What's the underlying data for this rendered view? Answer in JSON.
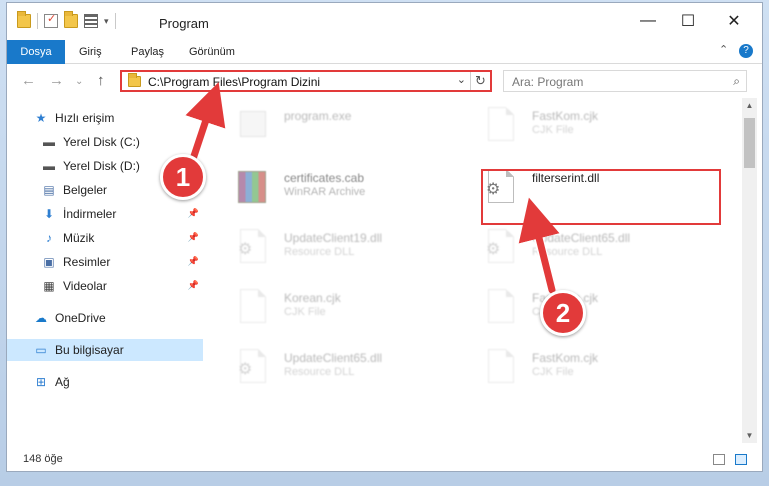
{
  "window": {
    "title": "Program",
    "minimize": "—",
    "maximize": "☐",
    "close": "✕"
  },
  "ribbon": {
    "tabs": [
      "Dosya",
      "Giriş",
      "Paylaş",
      "Görünüm"
    ],
    "active_tab": "Dosya",
    "accent_color": "#1979ca",
    "help": "?",
    "collapse": "⌃"
  },
  "nav": {
    "back": "←",
    "forward": "→",
    "recent": "⌄",
    "up": "↑",
    "address": "C:\\Program Files\\Program Dizini",
    "dropdown": "⌄",
    "refresh": "↻",
    "search_placeholder": "Ara: Program",
    "search_icon": "⌕"
  },
  "sidebar": {
    "items": [
      {
        "label": "Hızlı erişim",
        "icon": "star-icon",
        "glyph": "★",
        "pinned": false
      },
      {
        "label": "Yerel Disk (C:)",
        "icon": "drive-icon",
        "glyph": "▬",
        "pinned": false
      },
      {
        "label": "Yerel Disk (D:)",
        "icon": "drive-icon",
        "glyph": "▬",
        "pinned": false
      },
      {
        "label": "Belgeler",
        "icon": "documents-icon",
        "glyph": "▤",
        "pinned": false
      },
      {
        "label": "İndirmeler",
        "icon": "download-icon",
        "glyph": "⬇",
        "pinned": true
      },
      {
        "label": "Müzik",
        "icon": "music-icon",
        "glyph": "♪",
        "pinned": true
      },
      {
        "label": "Resimler",
        "icon": "pictures-icon",
        "glyph": "▣",
        "pinned": true
      },
      {
        "label": "Videolar",
        "icon": "video-icon",
        "glyph": "▦",
        "pinned": true
      },
      {
        "label": "OneDrive",
        "icon": "cloud-icon",
        "glyph": "☁",
        "pinned": false
      },
      {
        "label": "Bu bilgisayar",
        "icon": "computer-icon",
        "glyph": "▭",
        "pinned": false
      },
      {
        "label": "Ağ",
        "icon": "network-icon",
        "glyph": "⊞",
        "pinned": false
      }
    ],
    "pin_glyph": "📌",
    "selected": "Bu bilgisayar"
  },
  "files": [
    {
      "name": "program.exe",
      "type": "",
      "icon": "exe-icon"
    },
    {
      "name": "FastKom.cjk",
      "type": "CJK File",
      "icon": "file-icon"
    },
    {
      "name": "certificates.cab",
      "type": "WinRAR Archive",
      "icon": "rar-icon"
    },
    {
      "name": "filterserint.dll",
      "type": "",
      "icon": "dll-icon"
    },
    {
      "name": "UpdateClient19.dll",
      "type": "Resource DLL",
      "icon": "dll-icon"
    },
    {
      "name": "UpdateClient65.dll",
      "type": "Resource DLL",
      "icon": "dll-icon"
    },
    {
      "name": "Korean.cjk",
      "type": "CJK File",
      "icon": "file-icon"
    },
    {
      "name": "FastKom.cjk",
      "type": "CJK File",
      "icon": "file-icon"
    },
    {
      "name": "UpdateClient65.dll",
      "type": "Resource DLL",
      "icon": "dll-icon"
    },
    {
      "name": "FastKom.cjk",
      "type": "CJK File",
      "icon": "file-icon"
    }
  ],
  "highlighted_file": "filterserint.dll",
  "status": {
    "item_count": "148 öğe"
  },
  "annotations": {
    "step1": "1",
    "step2": "2",
    "color": "#e23a3a"
  }
}
